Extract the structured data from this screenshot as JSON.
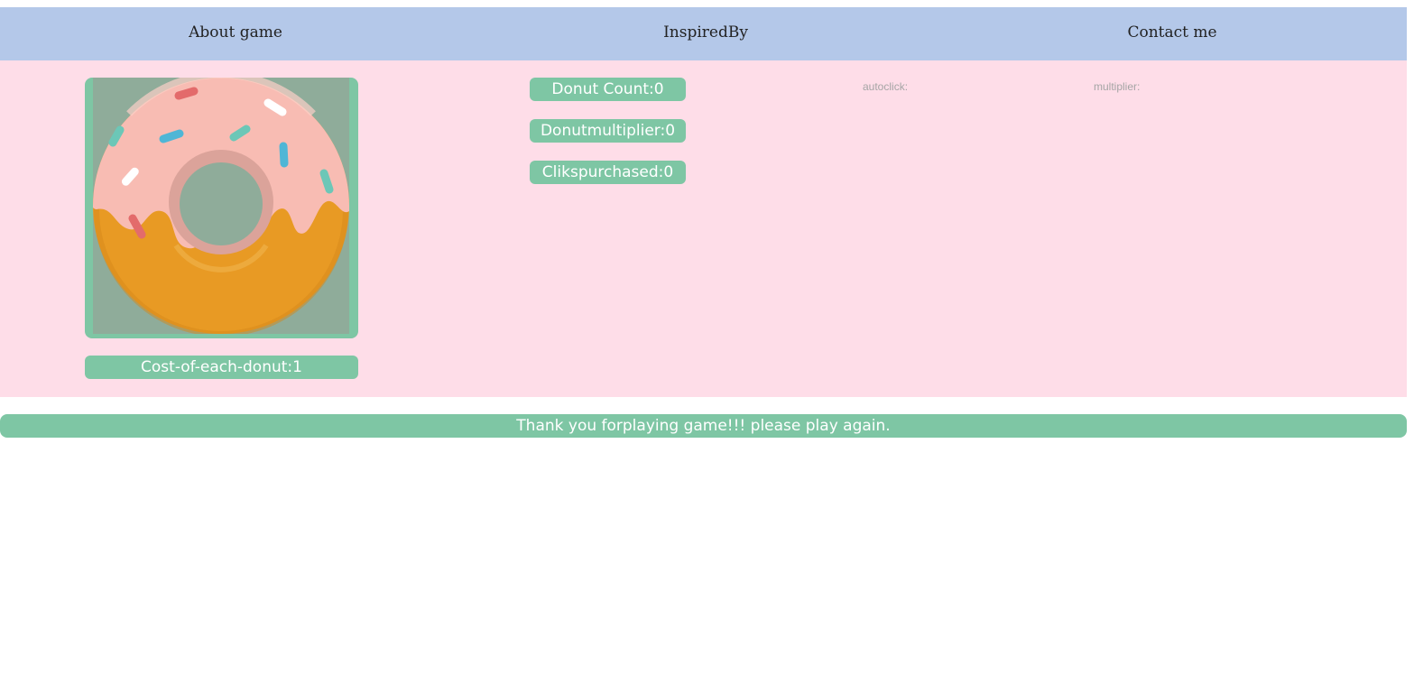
{
  "nav": {
    "items": [
      {
        "label": "About game"
      },
      {
        "label": "InspiredBy"
      },
      {
        "label": "Contact me"
      }
    ]
  },
  "game": {
    "donut_image": {
      "icon": "donut-icon"
    },
    "cost_label": "Cost-of-each-donut:1",
    "stats": {
      "donut_count": "Donut Count:0",
      "donut_multiplier": "Donutmultiplier:0",
      "clicks_purchased": "Clikspurchased:0"
    },
    "autoclick_label": "autoclick:",
    "multiplier_label": "multiplier:"
  },
  "footer": {
    "message": "Thank you forplaying game!!! please play again."
  },
  "colors": {
    "nav_bg": "#b4c8e9",
    "main_bg": "#fedde8",
    "accent_green": "#7ec6a4",
    "donut_dough": "#e89a24",
    "donut_icing": "#f8bcb3"
  }
}
